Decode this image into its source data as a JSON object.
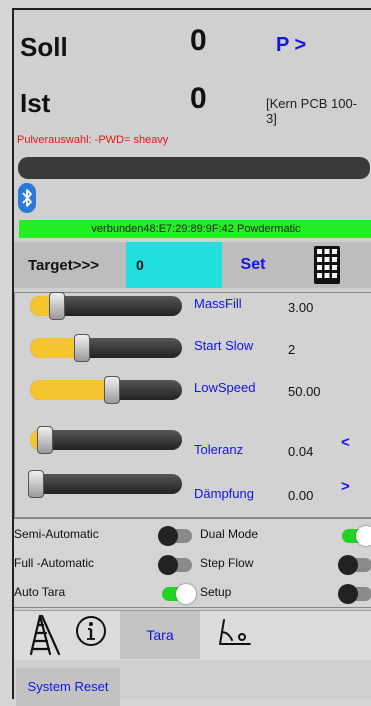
{
  "header": {
    "soll_label": "Soll",
    "soll_value": "0",
    "p_button": "P >",
    "ist_label": "Ist",
    "ist_value": "0",
    "scale_model": "[Kern PCB 100-3]",
    "powder_selection": "Pulverauswahl: -PWD= sheavy"
  },
  "bluetooth": {
    "status": "verbunden48:E7:29:89:9F:42 Powdermatic"
  },
  "target": {
    "label": "Target>>>",
    "value": "0",
    "set_label": "Set"
  },
  "sliders": [
    {
      "label": "MassFill",
      "value": "3.00",
      "level": 0.14
    },
    {
      "label": "Start Slow",
      "value": "2",
      "level": 0.3
    },
    {
      "label": "LowSpeed",
      "value": "50.00",
      "level": 0.5
    },
    {
      "label": "Toleranz",
      "value": "0.04",
      "level": 0.06,
      "arrow": "<"
    },
    {
      "label": "Dämpfung",
      "value": "0.00",
      "level": 0.0,
      "arrow": ">"
    }
  ],
  "switches": {
    "semi_automatic": {
      "label": "Semi-Automatic",
      "on": false
    },
    "full_automatic": {
      "label": "Full  -Automatic",
      "on": false
    },
    "auto_tara": {
      "label": "Auto Tara",
      "on": true
    },
    "dual_mode": {
      "label": "Dual Mode",
      "on": true
    },
    "step_flow": {
      "label": "Step Flow",
      "on": false
    },
    "setup": {
      "label": "Setup",
      "on": false
    }
  },
  "nav": {
    "tara_label": "Tara"
  },
  "footer": {
    "reset_label": "System Reset"
  },
  "colors": {
    "accent_blue": "#1414e6",
    "slider_fill": "#f6c431",
    "cyan_input": "#22dede",
    "green_status": "#22ee22",
    "error_red": "#e01818"
  }
}
